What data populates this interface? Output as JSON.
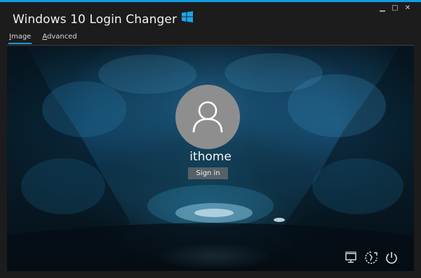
{
  "window": {
    "title": "Windows 10 Login Changer",
    "controls": {
      "minimize": "▁",
      "maximize": "□",
      "close": "✕"
    }
  },
  "tabs": [
    {
      "label_first": "I",
      "label_rest": "mage",
      "active": true
    },
    {
      "label_first": "A",
      "label_rest": "dvanced",
      "active": false
    }
  ],
  "login": {
    "username": "ithome",
    "sign_in_label": "Sign in"
  },
  "tray_icons": [
    "network-icon",
    "ease-of-access-icon",
    "power-icon"
  ],
  "colors": {
    "accent": "#0e9ee6",
    "window_bg": "#1c1c1c",
    "avatar_bg": "#8e8e8e"
  }
}
